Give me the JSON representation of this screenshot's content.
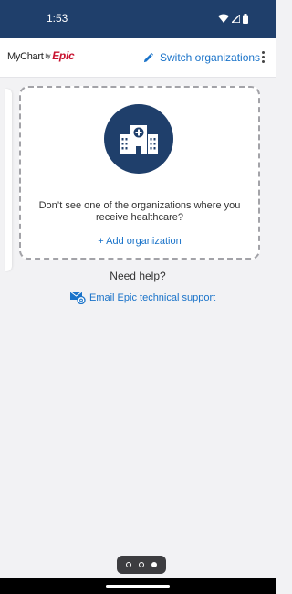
{
  "status_bar": {
    "time": "1:53",
    "icons": [
      "wifi-icon",
      "signal-icon",
      "battery-icon"
    ]
  },
  "header": {
    "logo": {
      "my": "MyChart",
      "by": "by",
      "epic": "Epic"
    },
    "switch_label": "Switch organizations",
    "switch_icon": "pencil-icon",
    "menu_icon": "kebab-menu-icon"
  },
  "org_card": {
    "icon": "hospital-icon",
    "message": "Don’t see one of the organizations where you receive healthcare?",
    "add_label": "+ Add organization"
  },
  "help": {
    "heading": "Need help?",
    "email_label": "Email Epic technical support",
    "email_icon": "email-support-icon"
  },
  "pager": {
    "pages": 3,
    "active_index": 2
  },
  "colors": {
    "status_bar": "#1f3f6b",
    "accent": "#1a73c9",
    "brand_red": "#c8102e",
    "icon_circle": "#1f3f6b",
    "background": "#f2f2f4"
  }
}
